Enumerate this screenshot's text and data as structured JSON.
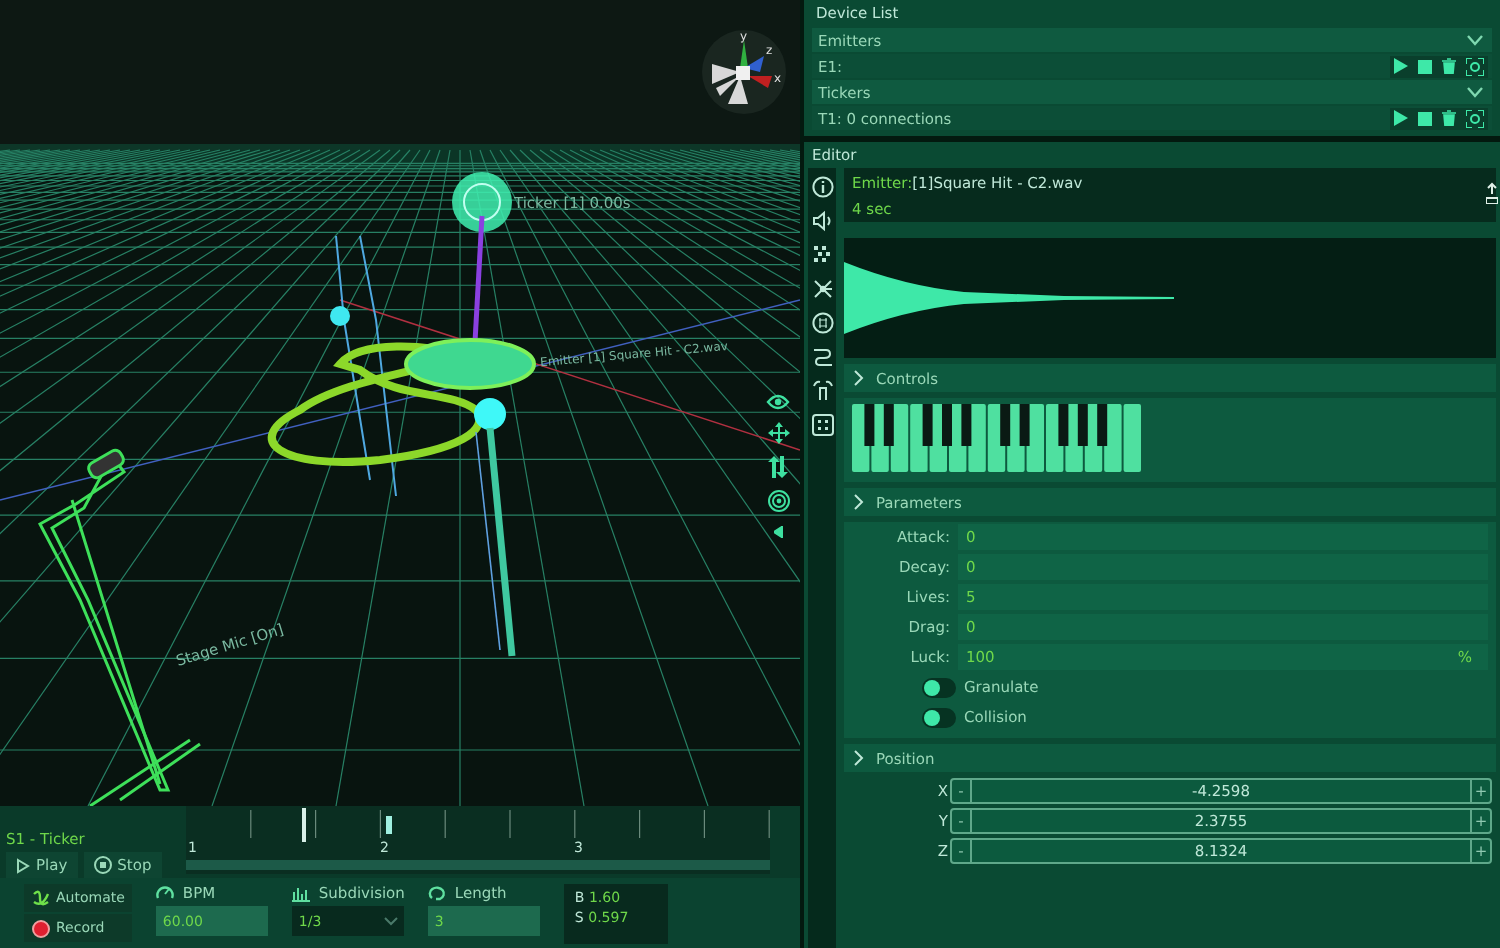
{
  "viewport": {
    "gizmo_axes": [
      "y",
      "z",
      "x"
    ],
    "scene_labels": [
      {
        "kind": "ticker",
        "text": "Ticker [1] 0.00s"
      },
      {
        "kind": "emitter",
        "text": "Emitter [1] Square Hit - C2.wav"
      },
      {
        "kind": "mic",
        "text": "Stage Mic [On]"
      }
    ]
  },
  "device_list": {
    "title": "Device List",
    "groups": [
      {
        "label": "Emitters",
        "expanded": true,
        "items": [
          {
            "label": "E1:"
          }
        ]
      },
      {
        "label": "Tickers",
        "expanded": true,
        "items": [
          {
            "label": "T1: 0 connections"
          }
        ]
      }
    ]
  },
  "editor": {
    "title": "Editor",
    "emitter_label": "Emitter:",
    "emitter_name": "[1]Square Hit - C2.wav",
    "duration": "4 sec",
    "controls_title": "Controls",
    "parameters_title": "Parameters",
    "parameters": [
      {
        "label": "Attack:",
        "value": "0"
      },
      {
        "label": "Decay:",
        "value": "0"
      },
      {
        "label": "Lives:",
        "value": "5"
      },
      {
        "label": "Drag:",
        "value": "0"
      },
      {
        "label": "Luck:",
        "value": "100",
        "unit": "%"
      }
    ],
    "toggles": [
      {
        "label": "Granulate",
        "on": false
      },
      {
        "label": "Collision",
        "on": false
      }
    ],
    "position_title": "Position",
    "position": [
      {
        "axis": "X",
        "minus": "-",
        "value": "-4.2598",
        "plus": "+"
      },
      {
        "axis": "Y",
        "minus": "-",
        "value": "2.3755",
        "plus": "+"
      },
      {
        "axis": "Z",
        "minus": "-",
        "value": "8.1324",
        "plus": "+"
      }
    ]
  },
  "sequencer": {
    "title": "S1 - Ticker",
    "ruler": [
      "1",
      "2",
      "3"
    ],
    "play": "Play",
    "stop": "Stop",
    "automate": "Automate",
    "record": "Record",
    "bpm": {
      "label": "BPM",
      "value": "60.00"
    },
    "subdivision": {
      "label": "Subdivision",
      "value": "1/3"
    },
    "length": {
      "label": "Length",
      "value": "3"
    },
    "readouts": [
      {
        "label": "B",
        "value": "1.60"
      },
      {
        "label": "S",
        "value": "0.597"
      }
    ]
  }
}
